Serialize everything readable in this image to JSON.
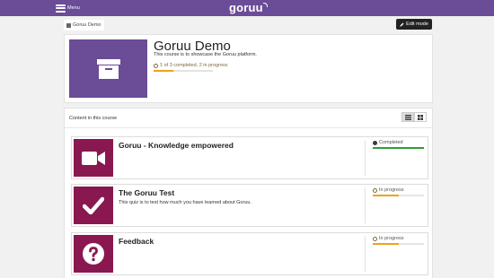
{
  "topbar": {
    "menu_label": "Menu",
    "logo": "goruu",
    "color": "#6b4c97"
  },
  "breadcrumb": {
    "label": "Goruu Demo",
    "icon": "home-icon"
  },
  "toolbar": {
    "edit_label": "Edit mode",
    "edit_icon": "pencil-icon"
  },
  "course": {
    "title": "Goruu Demo",
    "description": "This course is to showcase the Goruu platform.",
    "progress_text": "1 of 3 completed, 2 in progress",
    "progress_fraction": 0.33,
    "image_icon": "archive-box-icon"
  },
  "content": {
    "heading": "Content in this course",
    "views": [
      {
        "name": "list-view",
        "icon": "list-icon",
        "active": true
      },
      {
        "name": "grid-view",
        "icon": "grid-icon",
        "active": false
      }
    ],
    "activities": [
      {
        "title": "Goruu - Knowledge empowered",
        "description": "",
        "icon": "video-camera-icon",
        "status": "Completed",
        "progress_fraction": 1.0,
        "bar_color": "#2f9e3a"
      },
      {
        "title": "The Goruu Test",
        "description": "This quiz is to test how much you have learned about Goruu.",
        "icon": "checkmark-icon",
        "status": "In progress",
        "progress_fraction": 0.5,
        "bar_color": "#f0a21a"
      },
      {
        "title": "Feedback",
        "description": "",
        "icon": "question-mark-icon",
        "status": "In progress",
        "progress_fraction": 0.5,
        "bar_color": "#f0a21a"
      }
    ]
  },
  "colors": {
    "brand": "#6b4c97",
    "activity_thumb": "#8a1850",
    "complete": "#2f9e3a",
    "in_progress": "#f0a21a"
  }
}
